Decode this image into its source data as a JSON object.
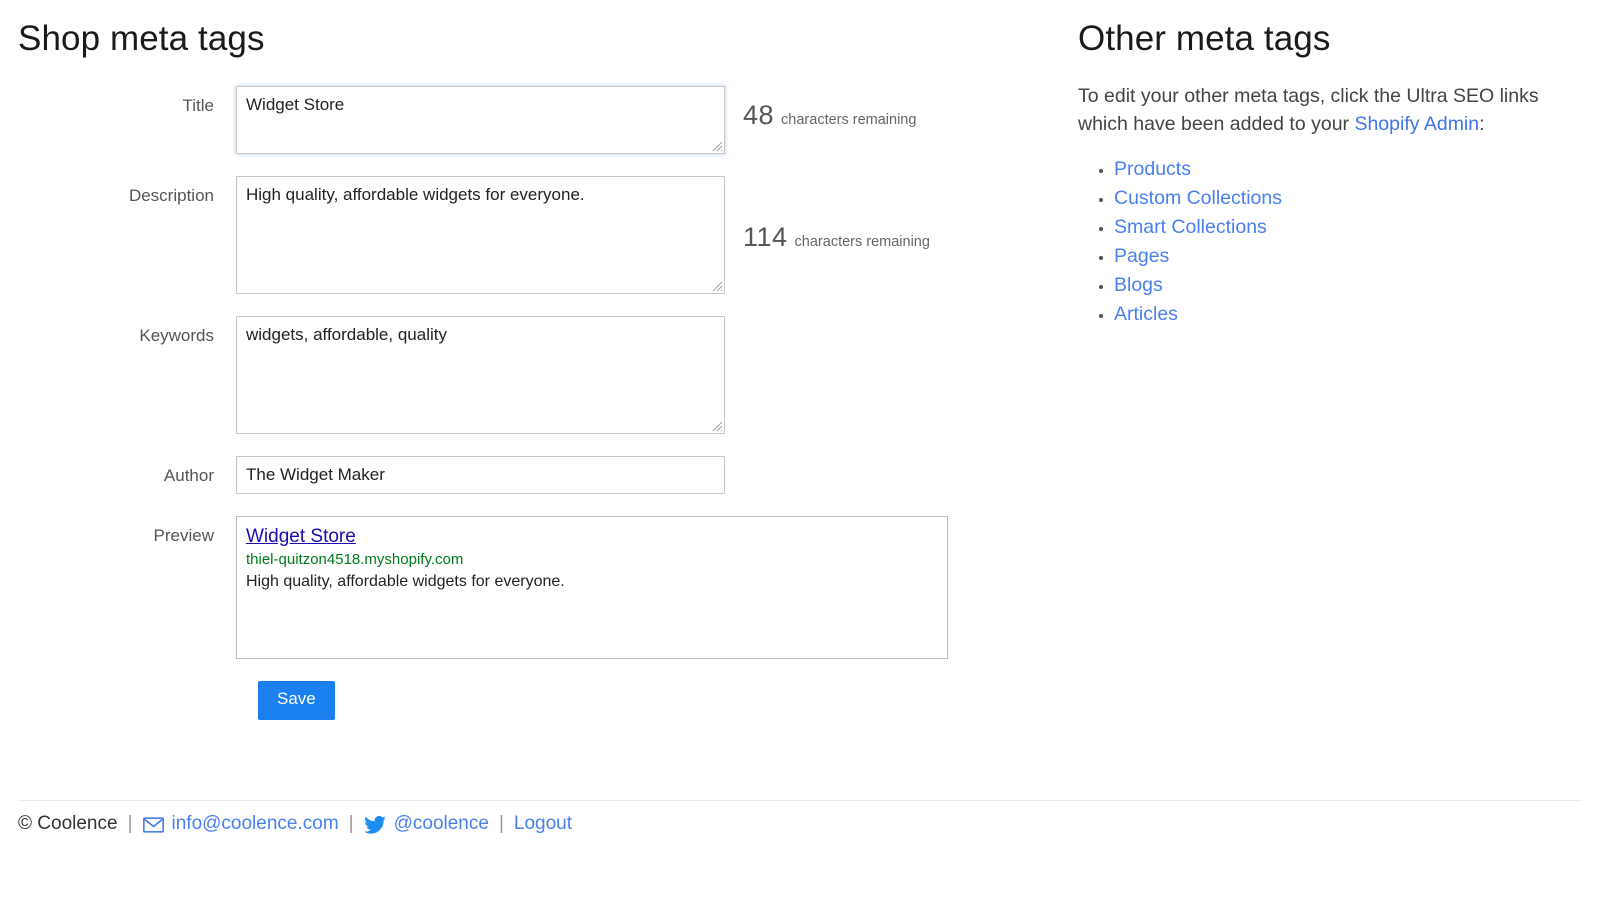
{
  "left": {
    "heading": "Shop meta tags",
    "fields": {
      "title": {
        "label": "Title",
        "value": "Widget Store",
        "placeholder": "",
        "counter_num": "48",
        "counter_label": "characters remaining"
      },
      "description": {
        "label": "Description",
        "value": "High quality, affordable widgets for everyone.",
        "placeholder": "",
        "counter_num": "114",
        "counter_label": "characters remaining"
      },
      "keywords": {
        "label": "Keywords",
        "value": "widgets, affordable, quality",
        "placeholder": ""
      },
      "author": {
        "label": "Author",
        "value": "The Widget Maker",
        "placeholder": ""
      },
      "preview": {
        "label": "Preview",
        "title": "Widget Store",
        "url": "thiel-quitzon4518.myshopify.com",
        "description": "High quality, affordable widgets for everyone."
      }
    },
    "save_label": "Save"
  },
  "right": {
    "heading": "Other meta tags",
    "intro_part1": "To edit your other meta tags, click the Ultra SEO links which have been added to your ",
    "intro_link": "Shopify Admin",
    "intro_part2": ":",
    "links": [
      {
        "label": "Products"
      },
      {
        "label": "Custom Collections"
      },
      {
        "label": "Smart Collections"
      },
      {
        "label": "Pages"
      },
      {
        "label": "Blogs"
      },
      {
        "label": "Articles"
      }
    ]
  },
  "footer": {
    "copyright": "© Coolence",
    "sep1": "|",
    "email": "info@coolence.com",
    "sep2": "|",
    "twitter": "@coolence",
    "sep3": "|",
    "logout": "Logout",
    "email_icon": "envelope-icon",
    "twitter_icon": "twitter-bird-icon"
  },
  "colors": {
    "accent_blue": "#1a80f0",
    "link_blue": "#4a7ff0",
    "preview_title_blue": "#1a0dab",
    "preview_url_green": "#007b1d",
    "focus_border": "#7ab0e0"
  }
}
